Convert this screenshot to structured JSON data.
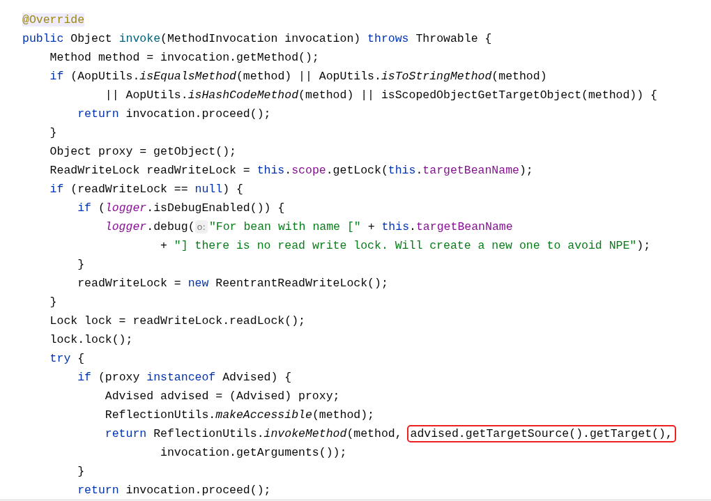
{
  "code_lines": [
    {
      "tokens": [
        {
          "text": "@Override",
          "kind": "annotation"
        }
      ]
    },
    {
      "tokens": [
        {
          "text": "public ",
          "kind": "keyword"
        },
        {
          "text": "Object ",
          "kind": "plain"
        },
        {
          "text": "invoke",
          "kind": "declaration"
        },
        {
          "text": "(MethodInvocation invocation) ",
          "kind": "plain"
        },
        {
          "text": "throws ",
          "kind": "keyword"
        },
        {
          "text": "Throwable {",
          "kind": "plain"
        }
      ],
      "children": [
        {
          "tokens": [
            {
              "text": "Method method = invocation.getMethod();",
              "kind": "plain"
            }
          ]
        },
        {
          "tokens": [
            {
              "text": "if ",
              "kind": "keyword"
            },
            {
              "text": "(AopUtils.",
              "kind": "plain"
            },
            {
              "text": "isEqualsMethod",
              "kind": "static"
            },
            {
              "text": "(method) || AopUtils.",
              "kind": "plain"
            },
            {
              "text": "isToStringMethod",
              "kind": "static"
            },
            {
              "text": "(method)",
              "kind": "plain"
            }
          ],
          "continued": [
            {
              "text": "|| AopUtils.",
              "kind": "plain"
            },
            {
              "text": "isHashCodeMethod",
              "kind": "static"
            },
            {
              "text": "(method) || isScopedObjectGetTargetObject(method)) {",
              "kind": "plain"
            }
          ],
          "children": [
            {
              "tokens": [
                {
                  "text": "return ",
                  "kind": "keyword"
                },
                {
                  "text": "invocation.proceed();",
                  "kind": "plain"
                }
              ]
            }
          ]
        },
        {
          "tokens": [
            {
              "text": "}",
              "kind": "plain"
            }
          ]
        },
        {
          "tokens": [
            {
              "text": "Object proxy = getObject();",
              "kind": "plain"
            }
          ]
        },
        {
          "tokens": [
            {
              "text": "ReadWriteLock readWriteLock = ",
              "kind": "plain"
            },
            {
              "text": "this",
              "kind": "keyword"
            },
            {
              "text": ".",
              "kind": "plain"
            },
            {
              "text": "scope",
              "kind": "field"
            },
            {
              "text": ".getLock(",
              "kind": "plain"
            },
            {
              "text": "this",
              "kind": "keyword"
            },
            {
              "text": ".",
              "kind": "plain"
            },
            {
              "text": "targetBeanName",
              "kind": "field"
            },
            {
              "text": ");",
              "kind": "plain"
            }
          ]
        },
        {
          "tokens": [
            {
              "text": "if ",
              "kind": "keyword"
            },
            {
              "text": "(readWriteLock == ",
              "kind": "plain"
            },
            {
              "text": "null",
              "kind": "keyword"
            },
            {
              "text": ") {",
              "kind": "plain"
            }
          ],
          "children": [
            {
              "tokens": [
                {
                  "text": "if ",
                  "kind": "keyword"
                },
                {
                  "text": "(",
                  "kind": "plain"
                },
                {
                  "text": "logger",
                  "kind": "static-field"
                },
                {
                  "text": ".isDebugEnabled()) {",
                  "kind": "plain"
                }
              ],
              "children": [
                {
                  "tokens": [
                    {
                      "text": "logger",
                      "kind": "static-field"
                    },
                    {
                      "text": ".debug(",
                      "kind": "plain"
                    },
                    {
                      "text": "o:",
                      "kind": "hint"
                    },
                    {
                      "text": "\"For bean with name [\"",
                      "kind": "string"
                    },
                    {
                      "text": " + ",
                      "kind": "plain"
                    },
                    {
                      "text": "this",
                      "kind": "keyword"
                    },
                    {
                      "text": ".",
                      "kind": "plain"
                    },
                    {
                      "text": "targetBeanName",
                      "kind": "field"
                    }
                  ],
                  "continued": [
                    {
                      "text": "+ ",
                      "kind": "plain"
                    },
                    {
                      "text": "\"] there is no read write lock. Will create a new one to avoid NPE\"",
                      "kind": "string"
                    },
                    {
                      "text": ");",
                      "kind": "plain"
                    }
                  ]
                }
              ]
            },
            {
              "tokens": [
                {
                  "text": "}",
                  "kind": "plain"
                }
              ]
            },
            {
              "tokens": [
                {
                  "text": "readWriteLock = ",
                  "kind": "plain"
                },
                {
                  "text": "new ",
                  "kind": "keyword"
                },
                {
                  "text": "ReentrantReadWriteLock();",
                  "kind": "plain"
                }
              ]
            }
          ]
        },
        {
          "tokens": [
            {
              "text": "}",
              "kind": "plain"
            }
          ]
        },
        {
          "tokens": [
            {
              "text": "Lock lock = readWriteLock.readLock();",
              "kind": "plain"
            }
          ]
        },
        {
          "tokens": [
            {
              "text": "lock.lock();",
              "kind": "plain"
            }
          ]
        },
        {
          "tokens": [
            {
              "text": "try ",
              "kind": "keyword"
            },
            {
              "text": "{",
              "kind": "plain"
            }
          ],
          "children": [
            {
              "tokens": [
                {
                  "text": "if ",
                  "kind": "keyword"
                },
                {
                  "text": "(proxy ",
                  "kind": "plain"
                },
                {
                  "text": "instanceof ",
                  "kind": "keyword"
                },
                {
                  "text": "Advised) {",
                  "kind": "plain"
                }
              ],
              "children": [
                {
                  "tokens": [
                    {
                      "text": "Advised advised = (Advised) proxy;",
                      "kind": "plain"
                    }
                  ]
                },
                {
                  "tokens": [
                    {
                      "text": "ReflectionUtils.",
                      "kind": "plain"
                    },
                    {
                      "text": "makeAccessible",
                      "kind": "static"
                    },
                    {
                      "text": "(method);",
                      "kind": "plain"
                    }
                  ]
                },
                {
                  "tokens": [
                    {
                      "text": "return ",
                      "kind": "keyword"
                    },
                    {
                      "text": "ReflectionUtils.",
                      "kind": "plain"
                    },
                    {
                      "text": "invokeMethod",
                      "kind": "static"
                    },
                    {
                      "text": "(method, ",
                      "kind": "plain"
                    },
                    {
                      "text": "advised.getTargetSource().getTarget(),",
                      "kind": "boxed"
                    }
                  ],
                  "continued": [
                    {
                      "text": "invocation.getArguments());",
                      "kind": "plain"
                    }
                  ]
                }
              ]
            },
            {
              "tokens": [
                {
                  "text": "}",
                  "kind": "plain"
                }
              ]
            },
            {
              "tokens": [
                {
                  "text": "return ",
                  "kind": "keyword"
                },
                {
                  "text": "invocation.proceed();",
                  "kind": "plain"
                }
              ]
            }
          ]
        }
      ]
    }
  ]
}
